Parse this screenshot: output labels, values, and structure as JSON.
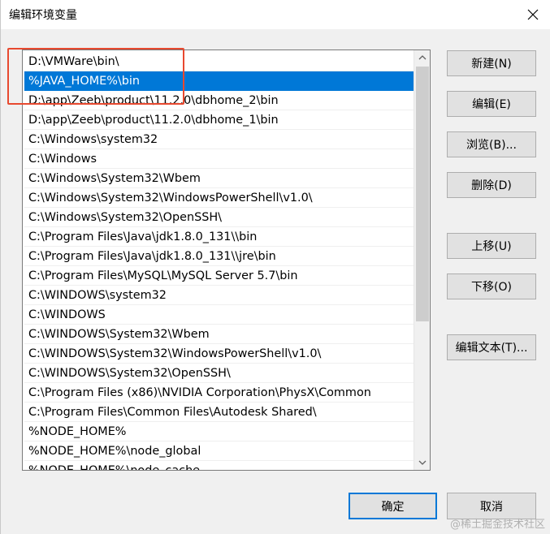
{
  "dialog": {
    "title": "编辑环境变量"
  },
  "list": {
    "items": [
      "D:\\VMWare\\bin\\",
      "%JAVA_HOME%\\bin",
      "D:\\app\\Zeeb\\product\\11.2.0\\dbhome_2\\bin",
      "D:\\app\\Zeeb\\product\\11.2.0\\dbhome_1\\bin",
      "C:\\Windows\\system32",
      "C:\\Windows",
      "C:\\Windows\\System32\\Wbem",
      "C:\\Windows\\System32\\WindowsPowerShell\\v1.0\\",
      "C:\\Windows\\System32\\OpenSSH\\",
      "C:\\Program Files\\Java\\jdk1.8.0_131\\\\bin",
      "C:\\Program Files\\Java\\jdk1.8.0_131\\\\jre\\bin",
      "C:\\Program Files\\MySQL\\MySQL Server 5.7\\bin",
      "C:\\WINDOWS\\system32",
      "C:\\WINDOWS",
      "C:\\WINDOWS\\System32\\Wbem",
      "C:\\WINDOWS\\System32\\WindowsPowerShell\\v1.0\\",
      "C:\\WINDOWS\\System32\\OpenSSH\\",
      "C:\\Program Files (x86)\\NVIDIA Corporation\\PhysX\\Common",
      "C:\\Program Files\\Common Files\\Autodesk Shared\\",
      "%NODE_HOME%",
      "%NODE_HOME%\\node_global",
      "%NODE_HOME%\\node_cache"
    ],
    "selected_index": 1
  },
  "buttons": {
    "new": "新建(N)",
    "edit": "编辑(E)",
    "browse": "浏览(B)...",
    "delete": "删除(D)",
    "move_up": "上移(U)",
    "move_down": "下移(O)",
    "edit_text": "编辑文本(T)...",
    "ok": "确定",
    "cancel": "取消"
  },
  "watermark": "@稀土掘金技术社区",
  "icons": {
    "close": "close-icon",
    "scroll_up": "chevron-up-icon",
    "scroll_down": "chevron-down-icon"
  },
  "colors": {
    "selection": "#0078d7",
    "highlight_box": "#e8492f"
  }
}
